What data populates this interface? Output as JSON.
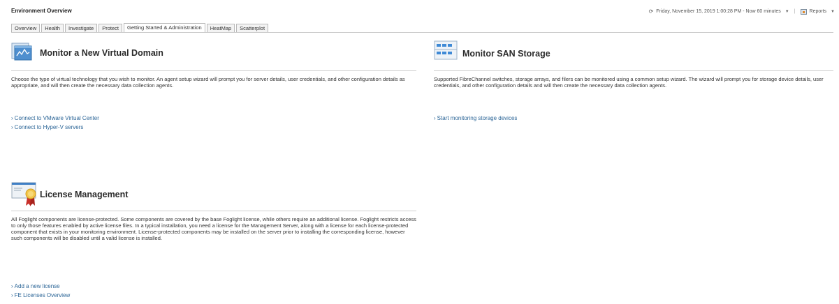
{
  "header": {
    "title": "Environment Overview",
    "time_range": "Friday, November 15, 2019 1:00:28 PM - Now 60 minutes",
    "reports_label": "Reports"
  },
  "tabs": [
    {
      "label": "Overview",
      "active": false
    },
    {
      "label": "Health",
      "active": false
    },
    {
      "label": "Investigate",
      "active": false
    },
    {
      "label": "Protect",
      "active": false
    },
    {
      "label": "Getting Started & Administration",
      "active": true
    },
    {
      "label": "HeatMap",
      "active": false
    },
    {
      "label": "Scatterplot",
      "active": false
    }
  ],
  "virtual": {
    "icon": "virtual-domain-icon",
    "title": "Monitor a New Virtual Domain",
    "description": "Choose the type of virtual technology that you wish to monitor. An agent setup wizard will prompt you for server details, user credentials, and other configuration details as appropriate, and will then create the necessary data collection agents.",
    "links": [
      "Connect to VMware Virtual Center",
      "Connect to Hyper-V servers"
    ]
  },
  "san": {
    "icon": "san-storage-icon",
    "title": "Monitor SAN Storage",
    "description": "Supported FibreChannel switches, storage arrays, and filers can be monitored using a common setup wizard. The wizard will prompt you for storage device details, user credentials, and other configuration details and will then create the necessary data collection agents.",
    "links": [
      "Start monitoring storage devices"
    ]
  },
  "license": {
    "icon": "license-certificate-icon",
    "title": "License Management",
    "description": "All Foglight components are license-protected. Some components are covered by the base Foglight license, while others require an additional license. Foglight restricts access to only those features enabled by active license files. In a typical installation, you need a license for the Management Server, along with a license for each license-protected component that exists in your monitoring environment. License-protected components may be installed on the server prior to installing the corresponding license, however such components will be disabled until a valid license is installed.",
    "links": [
      "Add a new license",
      "FE Licenses Overview"
    ]
  },
  "colors": {
    "link": "#2a6496",
    "tab_border": "#b8b8b8",
    "rule": "#cfcfcf"
  }
}
